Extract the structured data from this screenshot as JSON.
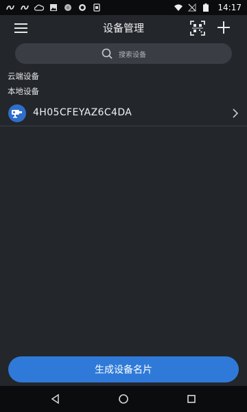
{
  "status_bar": {
    "time": "14:17",
    "left_icons": [
      "app-s-icon",
      "app-s-icon",
      "cloud-icon",
      "image-icon",
      "circle-icon",
      "eye-circle-icon",
      "doc-icon"
    ],
    "right_icons": [
      "wifi-icon",
      "no-signal-icon",
      "battery-icon"
    ]
  },
  "header": {
    "title": "设备管理",
    "menu_icon": "hamburger-menu-icon",
    "qr_icon": "qr-scan-icon",
    "add_icon": "plus-icon"
  },
  "search": {
    "placeholder": "搜索设备"
  },
  "sections": {
    "cloud_label": "云端设备",
    "local_label": "本地设备"
  },
  "devices": [
    {
      "name": "4H05CFEYAZ6C4DA",
      "icon": "camera-device-icon"
    }
  ],
  "actions": {
    "generate_label": "生成设备名片"
  },
  "nav_bar": {
    "icons": [
      "back-triangle-icon",
      "home-circle-icon",
      "recent-square-icon"
    ]
  },
  "colors": {
    "background": "#23262b",
    "status_bar": "#0b0c0e",
    "search_bg": "#3a3e44",
    "accent": "#2f7ad8"
  }
}
